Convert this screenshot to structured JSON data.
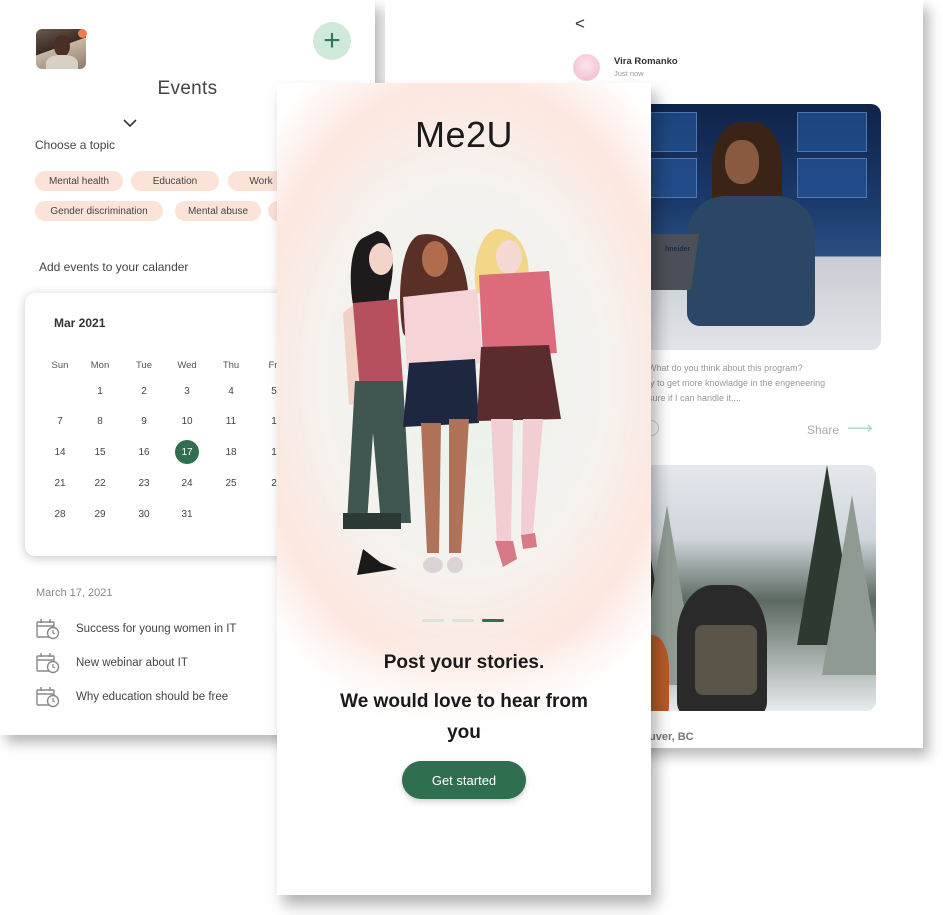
{
  "events_screen": {
    "title": "Events",
    "topic_label": "Choose a topic",
    "topics": [
      "Mental health",
      "Education",
      "Work",
      "Gender discrimination",
      "Mental abuse"
    ],
    "calendar_label": "Add events to your calander",
    "calendar": {
      "month": "Mar 2021",
      "weekdays": [
        "Sun",
        "Mon",
        "Tue",
        "Wed",
        "Thu",
        "Fri"
      ],
      "weeks": [
        [
          "",
          "1",
          "2",
          "3",
          "4",
          "5"
        ],
        [
          "7",
          "8",
          "9",
          "10",
          "11",
          "1"
        ],
        [
          "14",
          "15",
          "16",
          "17",
          "18",
          "1"
        ],
        [
          "21",
          "22",
          "23",
          "24",
          "25",
          "2"
        ],
        [
          "28",
          "29",
          "30",
          "31",
          "",
          ""
        ]
      ],
      "selected_day": "17"
    },
    "date_label": "March 17, 2021",
    "events": [
      "Success for young women in IT",
      "New webinar about IT",
      "Why education should be free"
    ]
  },
  "onboarding_screen": {
    "app_name": "Me2U",
    "headline": "Post your stories.",
    "subheadline_line1": "We would love to hear from",
    "subheadline_line2": "you",
    "cta_label": "Get started",
    "pager_active_index": 2,
    "pager_count": 3
  },
  "feed_screen": {
    "back_label": "<",
    "author_name": "Vira Romanko",
    "author_time": "Just now",
    "image_brand_text": "hneider",
    "caption_line1": "What do you think about this program?",
    "caption_line2": "ly to get more knowladge in the engeneering",
    "caption_line3": "sure if I can handle it....",
    "share_label": "Share",
    "share_arrow": "⟶",
    "location": "uver, BC"
  },
  "colors": {
    "primary_green": "#2f6e4f",
    "accent_green_light": "#cfe9da",
    "chip_peach": "#fbe3d8",
    "notification_orange": "#f07c4a"
  }
}
